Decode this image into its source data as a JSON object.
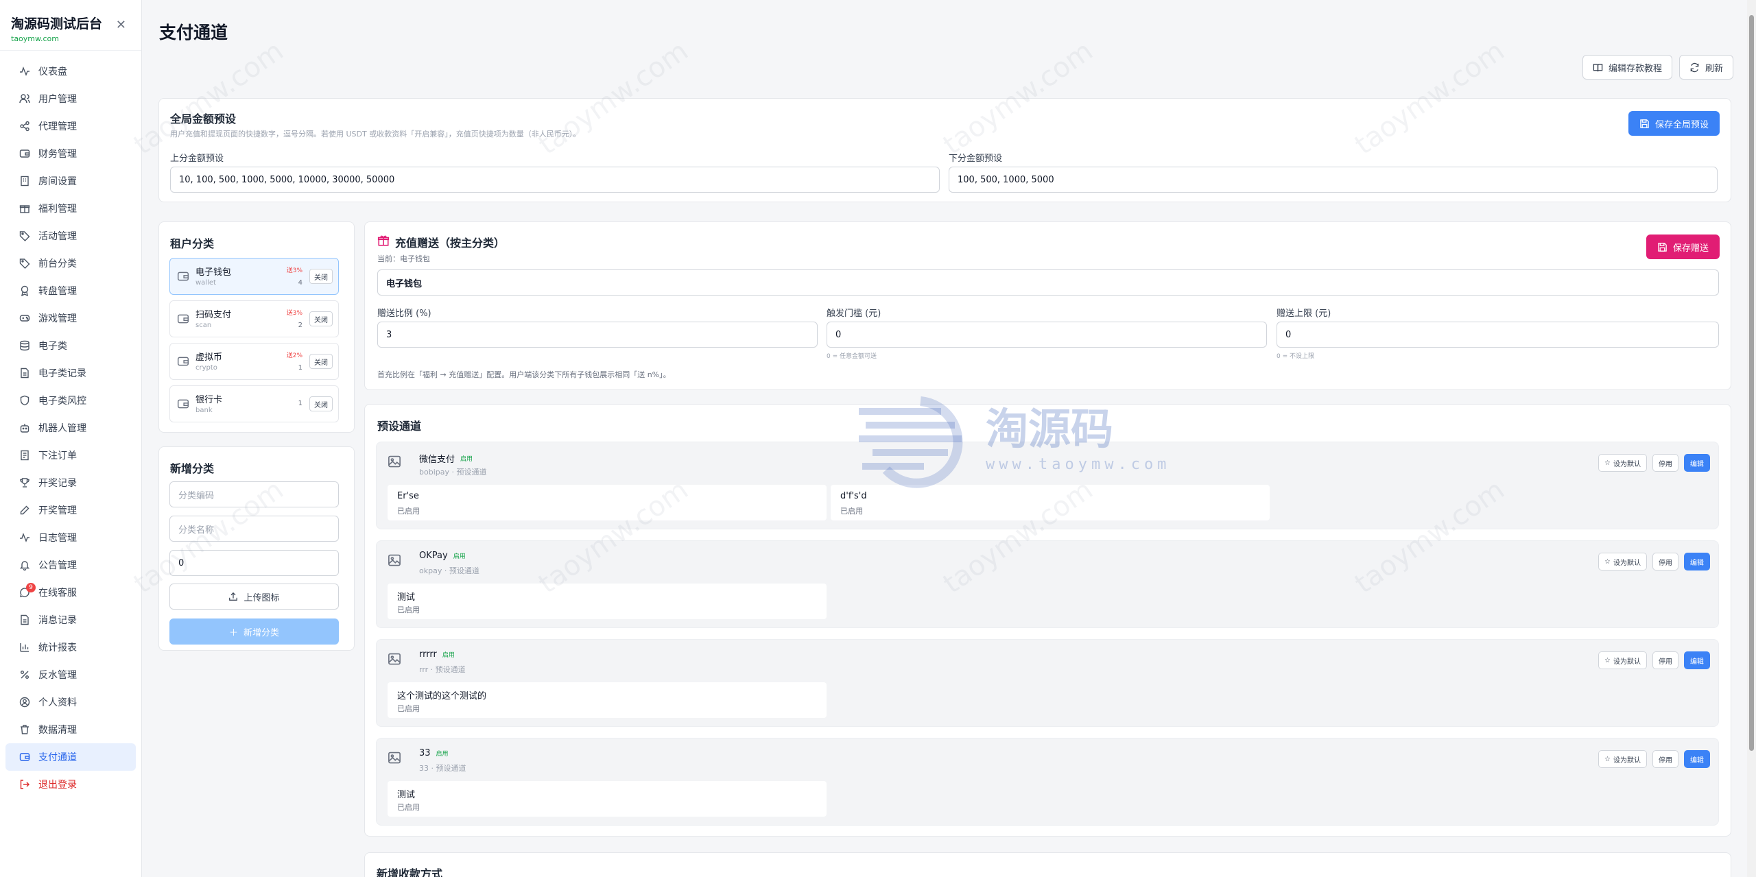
{
  "sidebar": {
    "title": "淘源码测试后台",
    "subtitle": "taoymw.com",
    "items": [
      {
        "label": "仪表盘"
      },
      {
        "label": "用户管理"
      },
      {
        "label": "代理管理"
      },
      {
        "label": "财务管理"
      },
      {
        "label": "房间设置"
      },
      {
        "label": "福利管理"
      },
      {
        "label": "活动管理"
      },
      {
        "label": "前台分类"
      },
      {
        "label": "转盘管理"
      },
      {
        "label": "游戏管理"
      },
      {
        "label": "电子类"
      },
      {
        "label": "电子类记录"
      },
      {
        "label": "电子类风控"
      },
      {
        "label": "机器人管理"
      },
      {
        "label": "下注订单"
      },
      {
        "label": "开奖记录"
      },
      {
        "label": "开奖管理"
      },
      {
        "label": "日志管理"
      },
      {
        "label": "公告管理"
      },
      {
        "label": "在线客服",
        "badge": "9"
      },
      {
        "label": "消息记录"
      },
      {
        "label": "统计报表"
      },
      {
        "label": "反水管理"
      },
      {
        "label": "个人资料"
      },
      {
        "label": "数据清理"
      },
      {
        "label": "支付通道"
      },
      {
        "label": "退出登录"
      }
    ]
  },
  "page": {
    "title": "支付通道",
    "tutorial_label": "编辑存款教程",
    "refresh_label": "刷新"
  },
  "global_presets": {
    "title": "全局金额预设",
    "desc": "用户充值和提现页面的快捷数字，逗号分隔。若使用 USDT 或收款资料「开启兼容」，充值页快捷项为数量（非人民币元）。",
    "save_label": "保存全局预设",
    "deposit_label": "上分金额预设",
    "deposit_value": "10, 100, 500, 1000, 5000, 10000, 30000, 50000",
    "withdraw_label": "下分金额预设",
    "withdraw_value": "100, 500, 1000, 5000"
  },
  "categories": {
    "title": "租户分类",
    "close_label": "关闭",
    "items": [
      {
        "name": "电子钱包",
        "code": "wallet",
        "gift": "送3%",
        "count": "4"
      },
      {
        "name": "扫码支付",
        "code": "scan",
        "gift": "送3%",
        "count": "2"
      },
      {
        "name": "虚拟币",
        "code": "crypto",
        "gift": "送2%",
        "count": "1"
      },
      {
        "name": "银行卡",
        "code": "bank",
        "gift": "",
        "count": "1"
      }
    ]
  },
  "new_category": {
    "title": "新增分类",
    "code_placeholder": "分类编码",
    "name_placeholder": "分类名称",
    "sort_value": "0",
    "upload_label": "上传图标",
    "add_label": "新增分类"
  },
  "gift": {
    "title": "充值赠送（按主分类）",
    "current": "当前：电子钱包",
    "save_label": "保存赠送",
    "category_value": "电子钱包",
    "ratio_label": "赠送比例 (%)",
    "ratio_value": "3",
    "threshold_label": "触发门槛 (元)",
    "threshold_value": "0",
    "threshold_hint": "0 = 任意金额可送",
    "cap_label": "赠送上限 (元)",
    "cap_value": "0",
    "cap_hint": "0 = 不设上限",
    "note": "首充比例在「福利 → 充值赠送」配置。用户端该分类下所有子钱包展示相同「送 n%」。"
  },
  "channels": {
    "title": "预设通道",
    "set_default_label": "设为默认",
    "disable_label": "停用",
    "edit_label": "编辑",
    "items": [
      {
        "name": "微信支付",
        "status": "启用",
        "sub": "bobipay · 预设通道",
        "wallets": [
          {
            "name": "Er'se",
            "status": "已启用"
          },
          {
            "name": "d'f's'd",
            "status": "已启用"
          }
        ]
      },
      {
        "name": "OKPay",
        "status": "启用",
        "sub": "okpay · 预设通道",
        "wallets": [
          {
            "name": "测试",
            "status": "已启用"
          }
        ]
      },
      {
        "name": "rrrrr",
        "status": "启用",
        "sub": "rrr · 预设通道",
        "wallets": [
          {
            "name": "这个测试的这个测试的",
            "status": "已启用"
          }
        ]
      },
      {
        "name": "33",
        "status": "启用",
        "sub": "33 · 预设通道",
        "wallets": [
          {
            "name": "测试",
            "status": "已启用"
          }
        ]
      }
    ]
  },
  "new_payment": {
    "title": "新增收款方式"
  },
  "watermark": {
    "text": "淘源码",
    "url": "www.taoymw.com",
    "diag": "taoymw.com"
  },
  "colors": {
    "primary": "#3b82f6",
    "pink": "#e11d74",
    "success": "#16a34a",
    "danger": "#ef4444"
  }
}
